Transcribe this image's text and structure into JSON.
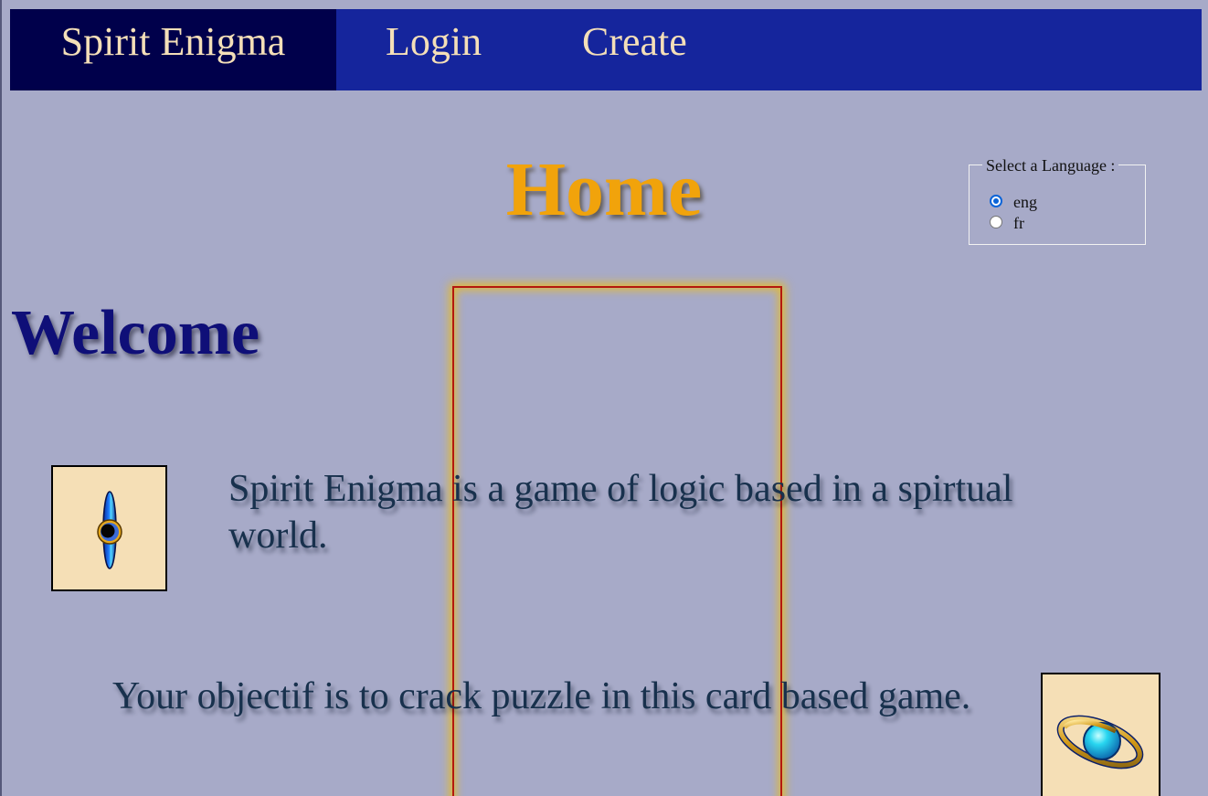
{
  "nav": {
    "brand": "Spirit Enigma",
    "login": "Login",
    "create": "Create"
  },
  "page": {
    "title": "Home"
  },
  "language": {
    "legend": "Select a Language :",
    "options": [
      {
        "label": "eng",
        "checked": true
      },
      {
        "label": "fr",
        "checked": false
      }
    ]
  },
  "content": {
    "welcome": "Welcome",
    "paragraph_1": "Spirit Enigma is a game of logic based in a spirtual world.",
    "paragraph_2": "Your objectif is to crack puzzle in this card based game."
  },
  "icons": {
    "card_1": "spirit-eye-icon",
    "card_2": "planet-orb-icon"
  },
  "colors": {
    "background": "#a7aac8",
    "navbar": "#15259c",
    "nav_brand_bg": "#00004b",
    "nav_text": "#f4dfb8",
    "title": "#f1a30b",
    "welcome": "#0f0f78",
    "paragraph": "#18314d",
    "card_border": "#b4180d",
    "card_glow": "#f0be14",
    "icon_bg": "#f5dfb6"
  }
}
